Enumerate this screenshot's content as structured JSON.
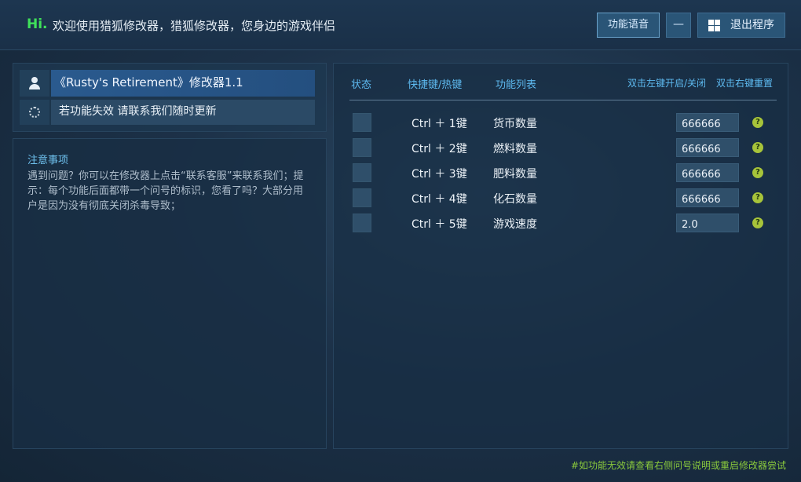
{
  "header": {
    "hi": "Hi.",
    "welcome": "欢迎使用猎狐修改器，猎狐修改器，您身边的游戏伴侣",
    "voice_button": "功能语音",
    "minimize_button": "—",
    "exit_button": "退出程序"
  },
  "left": {
    "game_title": "《Rusty's Retirement》修改器1.1",
    "notice": "若功能失效  请联系我们随时更新",
    "notes_title": "注意事项",
    "notes_text": "遇到问题？你可以在修改器上点击“联系客服”来联系我们；提示：每个功能后面都带一个问号的标识，您看了吗？大部分用户是因为没有彻底关闭杀毒导致；"
  },
  "table": {
    "headers": {
      "status": "状态",
      "hotkey": "快捷键/热键",
      "features": "功能列表",
      "toggle_hint": "双击左键开启/关闭",
      "reset_hint": "双击右键重置"
    },
    "rows": [
      {
        "hotkey": "Ctrl ＋ 1键",
        "feature": "货币数量",
        "value": "666666"
      },
      {
        "hotkey": "Ctrl ＋ 2键",
        "feature": "燃料数量",
        "value": "666666"
      },
      {
        "hotkey": "Ctrl ＋ 3键",
        "feature": "肥料数量",
        "value": "666666"
      },
      {
        "hotkey": "Ctrl ＋ 4键",
        "feature": "化石数量",
        "value": "666666"
      },
      {
        "hotkey": "Ctrl ＋ 5键",
        "feature": "游戏速度",
        "value": "2.0"
      }
    ],
    "help_glyph": "?"
  },
  "footer": "#如功能无效请查看右侧问号说明或重启修改器尝试",
  "colors": {
    "accent": "#5db9ef",
    "hi_green": "#3fe05a",
    "help_green": "#a7c43a",
    "footer_green": "#8ac93c"
  }
}
